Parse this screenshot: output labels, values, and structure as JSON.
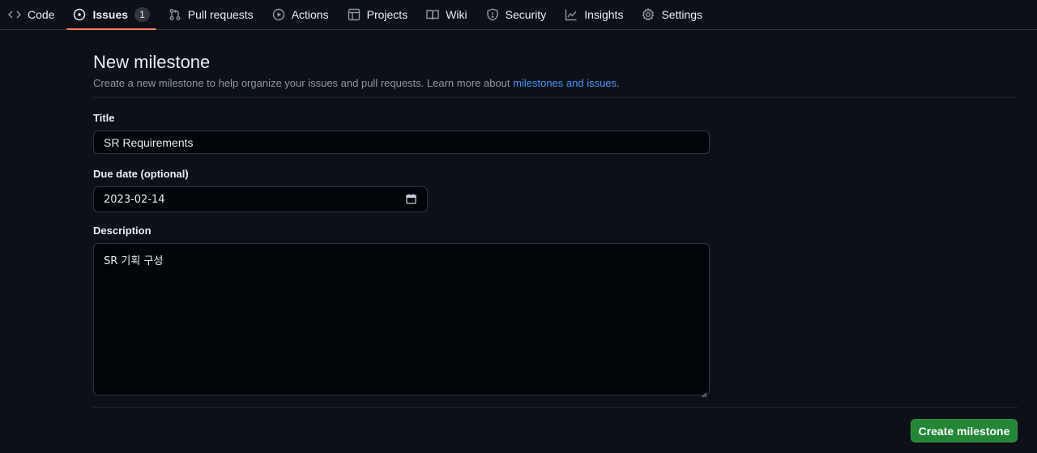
{
  "nav": {
    "items": [
      {
        "label": "Code",
        "icon": "code-icon"
      },
      {
        "label": "Issues",
        "icon": "issue-opened-icon",
        "count": "1",
        "selected": true
      },
      {
        "label": "Pull requests",
        "icon": "git-pull-request-icon"
      },
      {
        "label": "Actions",
        "icon": "play-icon"
      },
      {
        "label": "Projects",
        "icon": "table-icon"
      },
      {
        "label": "Wiki",
        "icon": "book-icon"
      },
      {
        "label": "Security",
        "icon": "shield-icon"
      },
      {
        "label": "Insights",
        "icon": "graph-icon"
      },
      {
        "label": "Settings",
        "icon": "gear-icon"
      }
    ]
  },
  "page": {
    "title": "New milestone",
    "description": "Create a new milestone to help organize your issues and pull requests. Learn more about ",
    "description_link": "milestones and issues",
    "description_end": "."
  },
  "form": {
    "title_label": "Title",
    "title_value": "SR Requirements",
    "due_label": "Due date (optional)",
    "due_value": "2023-02-14",
    "description_label": "Description",
    "description_value": "SR 기획 구성",
    "submit_label": "Create milestone"
  },
  "colors": {
    "background": "#0d1117",
    "accent_underline": "#f78166",
    "link": "#4493f8",
    "primary_button": "#238636"
  }
}
